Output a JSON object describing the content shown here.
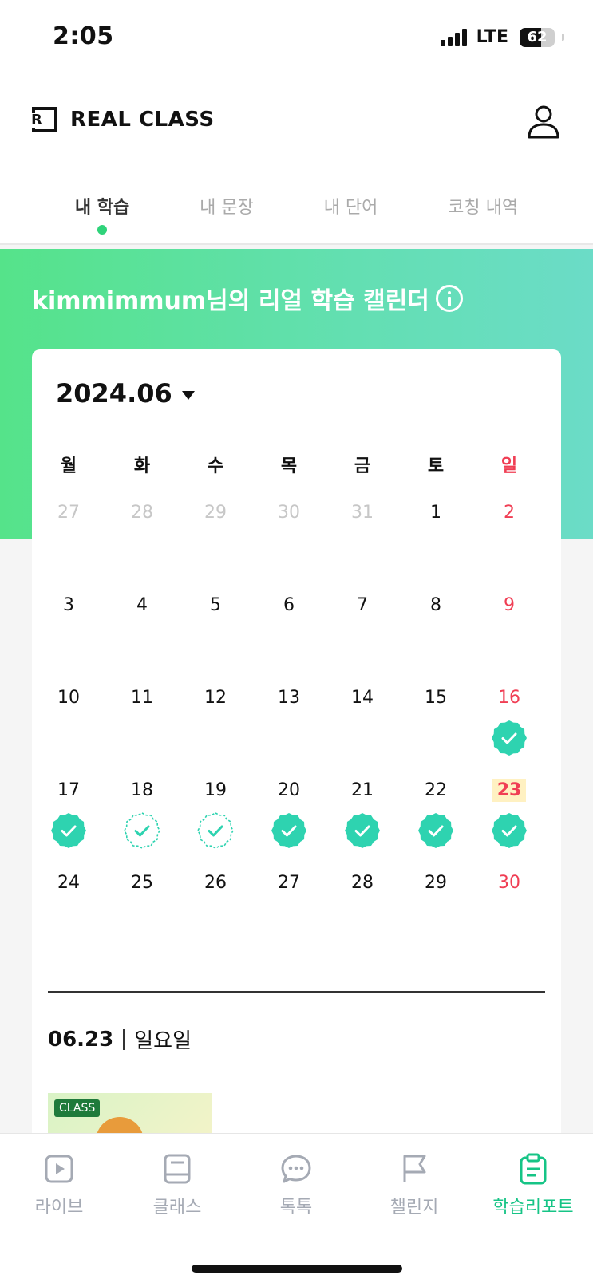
{
  "status": {
    "time": "2:05",
    "network": "LTE",
    "battery": "62",
    "battery_level": 0.62
  },
  "header": {
    "logo_text": "REAL CLASS",
    "logo_mark": "R"
  },
  "tabs": [
    {
      "label": "내 학습",
      "active": true
    },
    {
      "label": "내 문장",
      "active": false
    },
    {
      "label": "내 단어",
      "active": false
    },
    {
      "label": "코칭 내역",
      "active": false
    }
  ],
  "hero": {
    "title": "kimmimmum님의 리얼 학습 캘린더"
  },
  "calendar": {
    "month": "2024.06",
    "weekdays": [
      "월",
      "화",
      "수",
      "목",
      "금",
      "토",
      "일"
    ],
    "weeks": [
      [
        {
          "d": "27",
          "muted": true
        },
        {
          "d": "28",
          "muted": true
        },
        {
          "d": "29",
          "muted": true
        },
        {
          "d": "30",
          "muted": true
        },
        {
          "d": "31",
          "muted": true
        },
        {
          "d": "1"
        },
        {
          "d": "2",
          "sun": true
        }
      ],
      [
        {
          "d": "3"
        },
        {
          "d": "4"
        },
        {
          "d": "5"
        },
        {
          "d": "6"
        },
        {
          "d": "7"
        },
        {
          "d": "8"
        },
        {
          "d": "9",
          "sun": true
        }
      ],
      [
        {
          "d": "10"
        },
        {
          "d": "11"
        },
        {
          "d": "12"
        },
        {
          "d": "13"
        },
        {
          "d": "14"
        },
        {
          "d": "15"
        },
        {
          "d": "16",
          "sun": true,
          "badge": "filled"
        }
      ],
      [
        {
          "d": "17",
          "badge": "filled"
        },
        {
          "d": "18",
          "badge": "outline"
        },
        {
          "d": "19",
          "badge": "outline"
        },
        {
          "d": "20",
          "badge": "filled"
        },
        {
          "d": "21",
          "badge": "filled"
        },
        {
          "d": "22",
          "badge": "filled"
        },
        {
          "d": "23",
          "sun": true,
          "today": true,
          "badge": "filled"
        }
      ],
      [
        {
          "d": "24"
        },
        {
          "d": "25"
        },
        {
          "d": "26"
        },
        {
          "d": "27"
        },
        {
          "d": "28"
        },
        {
          "d": "29"
        },
        {
          "d": "30",
          "sun": true
        }
      ]
    ]
  },
  "selected": {
    "date": "06.23",
    "weekday": "일요일"
  },
  "lesson": {
    "badge": "CLASS"
  },
  "bottom_nav": [
    {
      "label": "라이브",
      "icon": "play-icon",
      "active": false
    },
    {
      "label": "클래스",
      "icon": "book-icon",
      "active": false
    },
    {
      "label": "톡톡",
      "icon": "chat-icon",
      "active": false
    },
    {
      "label": "챌린지",
      "icon": "flag-icon",
      "active": false
    },
    {
      "label": "학습리포트",
      "icon": "clipboard-icon",
      "active": true
    }
  ],
  "colors": {
    "accent": "#16c486",
    "badge": "#2ed3b0",
    "sunday": "#f03e54",
    "hero_start": "#55e38a",
    "hero_end": "#6bdcc7"
  }
}
